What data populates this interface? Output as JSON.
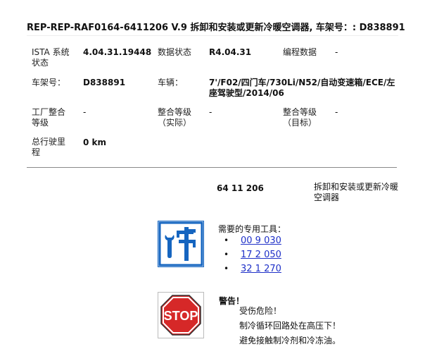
{
  "header": {
    "title": "REP-REP-RAF0164-6411206   V.9   拆卸和安装或更新冷暖空调器, 车架号：: D838891"
  },
  "info": {
    "ista_label": "ISTA 系统状态",
    "ista_value": "4.04.31.19448",
    "data_status_label": "数据状态",
    "data_status_value": "R4.04.31",
    "programming_label": "编程数据",
    "programming_value": "-",
    "vin_label": "车架号：",
    "vin_value": "D838891",
    "vehicle_label": "车辆：",
    "vehicle_value": "7'/F02/四门车/730Li/N52/自动变速箱/ECE/左座驾驶型/2014/06",
    "factory_label": "工厂整合等级",
    "factory_value": "-",
    "integ_actual_label": "整合等级（实际）",
    "integ_actual_value": "-",
    "integ_target_label": "整合等级（目标）",
    "integ_target_value": "-",
    "mileage_label": "总行驶里程",
    "mileage_value": "0 km"
  },
  "operation": {
    "number": "64 11 206",
    "description": "拆卸和安装或更新冷暖空调器"
  },
  "tools": {
    "icon": "caliper-wrench-icon",
    "heading": "需要的专用工具：",
    "items": [
      "00 9 030",
      "17 2 050",
      "32 1 270"
    ],
    "link_color": "#1f31c8",
    "icon_color": "#1565c0"
  },
  "warning": {
    "icon": "stop-sign-icon",
    "heading": "警告！",
    "lines": [
      "受伤危险！",
      "制冷循环回路处在高压下！",
      "避免接触制冷剂和冷冻油。"
    ],
    "stop_text": "STOP",
    "stop_color": "#d62828"
  }
}
